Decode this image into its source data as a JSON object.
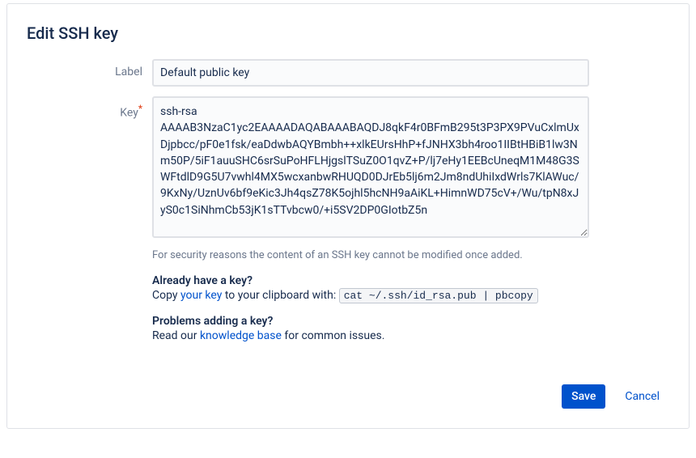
{
  "dialog": {
    "title": "Edit SSH key",
    "fields": {
      "label": {
        "label": "Label",
        "value": "Default public key"
      },
      "key": {
        "label": "Key",
        "value": "ssh-rsa AAAAB3NzaC1yc2EAAAADAQABAAABAQDJ8qkF4r0BFmB295t3P3PX9PVuCxlmUxDjpbcc/pF0e1fsk/eaDdwbAQYBmbh++xlkEUrsHhP+fJNHX3bh4roo1IIBtHBiB1lw3Nm50P/5iF1auuSHC6srSuPoHFLHjgslTSuZ0O1qvZ+P/lj7eHy1EEBcUneqM1M48G3SWFtdlD9G5U7vwhl4MX5wcxanbwRHUQD0DJrEb5lj6m2Jm8ndUhiIxdWrls7KlAWuc/9KxNy/UznUv6bf9eKic3Jh4qsZ78K5ojhl5hcNH9aAiKL+HimnWD75cV+/Wu/tpN8xJyS0c1SiNhmCb53jK1sTTvbcw0/+i5SV2DP0GIotbZ5n"
      }
    },
    "helptext": "For security reasons the content of an SSH key cannot be modified once added.",
    "help": {
      "already_heading": "Already have a key?",
      "already_pre": "Copy ",
      "already_link": "your key",
      "already_post": " to your clipboard with: ",
      "already_cmd": "cat ~/.ssh/id_rsa.pub | pbcopy",
      "problems_heading": "Problems adding a key?",
      "problems_pre": "Read our ",
      "problems_link": "knowledge base",
      "problems_post": " for common issues."
    },
    "buttons": {
      "save": "Save",
      "cancel": "Cancel"
    }
  }
}
